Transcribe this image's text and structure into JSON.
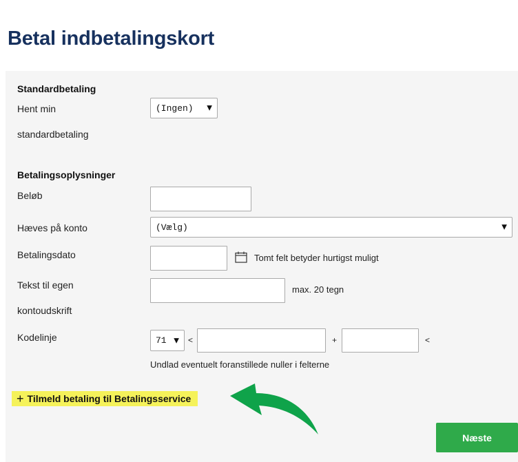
{
  "page": {
    "title": "Betal indbetalingskort"
  },
  "standard": {
    "heading": "Standardbetaling",
    "label_line1": "Hent min",
    "label_line2": "standardbetaling",
    "select_value": "(Ingen)"
  },
  "details": {
    "heading": "Betalingsoplysninger",
    "amount_label": "Beløb",
    "amount_value": "",
    "account_label": "Hæves på konto",
    "account_value": "(Vælg)",
    "date_label": "Betalingsdato",
    "date_value": "",
    "date_hint": "Tomt felt betyder hurtigst muligt",
    "text_label_line1": "Tekst til egen",
    "text_label_line2": "kontoudskrift",
    "text_value": "",
    "text_hint": "max. 20 tegn",
    "codeline_label": "Kodelinje",
    "codeline_type": "71",
    "codeline_sep_open": "<",
    "codeline_sep_plus": "+",
    "codeline_sep_close": "<",
    "codeline_field1": "",
    "codeline_field2": "",
    "codeline_hint": "Undlad eventuelt foranstillede nuller i felterne"
  },
  "actions": {
    "register_label": "Tilmeld betaling til Betalingsservice",
    "next_label": "Næste"
  },
  "icons": {
    "dropdown": "chevron-down-icon",
    "calendar": "calendar-icon",
    "plus": "plus-icon",
    "annotation": "green-arrow-annotation"
  },
  "colors": {
    "title": "#17315e",
    "panel_bg": "#f5f5f5",
    "highlight": "#f5f25a",
    "next_button": "#2faa4a",
    "annotation_arrow": "#0fa34a"
  }
}
